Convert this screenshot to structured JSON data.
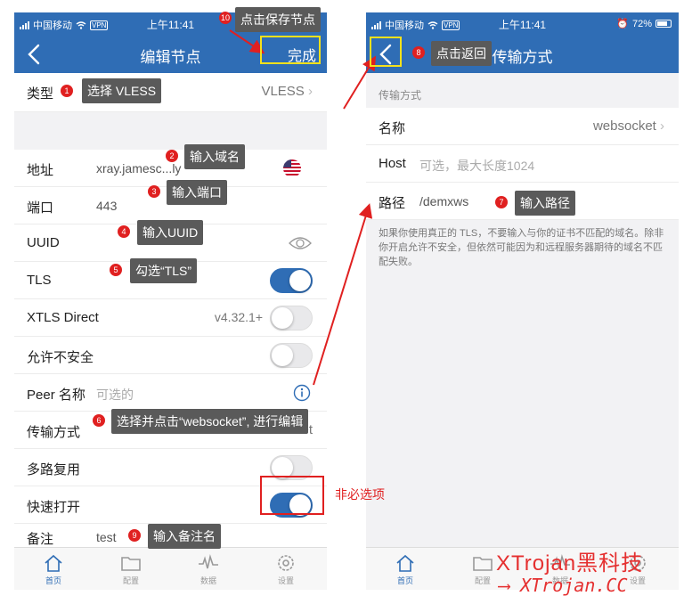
{
  "status_left": {
    "carrier": "中国移动",
    "vpn": "VPN",
    "time": "上午11:41"
  },
  "status_right": {
    "carrier": "中国移动",
    "vpn": "VPN",
    "time": "上午11:41",
    "battery": "72%"
  },
  "left": {
    "title": "编辑节点",
    "done": "完成",
    "type_label": "类型",
    "type_value": "VLESS",
    "address_label": "地址",
    "address_value": "xray.jamesc...ly",
    "port_label": "端口",
    "port_value": "443",
    "uuid_label": "UUID",
    "tls_label": "TLS",
    "tls_on": true,
    "xtls_label": "XTLS Direct",
    "xtls_version": "v4.32.1+",
    "xtls_on": false,
    "insecure_label": "允许不安全",
    "insecure_on": false,
    "peer_label": "Peer 名称",
    "peer_placeholder": "可选的",
    "transport_label": "传输方式",
    "transport_value": "cket",
    "mux_label": "多路复用",
    "mux_on": false,
    "fastopen_label": "快速打开",
    "fastopen_on": true,
    "remark_label": "备注",
    "remark_value": "test"
  },
  "right": {
    "title": "传输方式",
    "section": "传输方式",
    "name_label": "名称",
    "name_value": "websocket",
    "host_label": "Host",
    "host_placeholder": "可选，最大长度1024",
    "path_label": "路径",
    "path_value": "/demxws",
    "hint": "如果你使用真正的 TLS，不要输入与你的证书不匹配的域名。除非你开启允许不安全，但依然可能因为和远程服务器期待的域名不匹配失败。"
  },
  "tabs": [
    {
      "label": "首页",
      "icon": "home-icon"
    },
    {
      "label": "配置",
      "icon": "folder-icon"
    },
    {
      "label": "数据",
      "icon": "chart-icon"
    },
    {
      "label": "设置",
      "icon": "gear-icon"
    }
  ],
  "callouts": {
    "c1": {
      "num": "1",
      "text": "选择 VLESS"
    },
    "c2": {
      "num": "2",
      "text": "输入域名"
    },
    "c3": {
      "num": "3",
      "text": "输入端口"
    },
    "c4": {
      "num": "4",
      "text": "输入UUID"
    },
    "c5": {
      "num": "5",
      "text": "勾选“TLS”"
    },
    "c6": {
      "num": "6",
      "text": "选择并点击“websocket”, 进行编辑"
    },
    "c7": {
      "num": "7",
      "text": "输入路径"
    },
    "c8": {
      "num": "8",
      "text": "点击返回"
    },
    "c9": {
      "num": "9",
      "text": "输入备注名"
    },
    "c10": {
      "num": "10",
      "text": "点击保存节点"
    }
  },
  "optional_note": "非必选项",
  "watermark": {
    "line1": "XTrojan黑科技",
    "line2": "XTrojan.CC"
  },
  "colors": {
    "nav": "#2f6db5",
    "callout_bg": "#5a5a5a",
    "badge": "#e02020",
    "highlight_yellow": "#f5e11b",
    "highlight_red": "#e02020"
  }
}
